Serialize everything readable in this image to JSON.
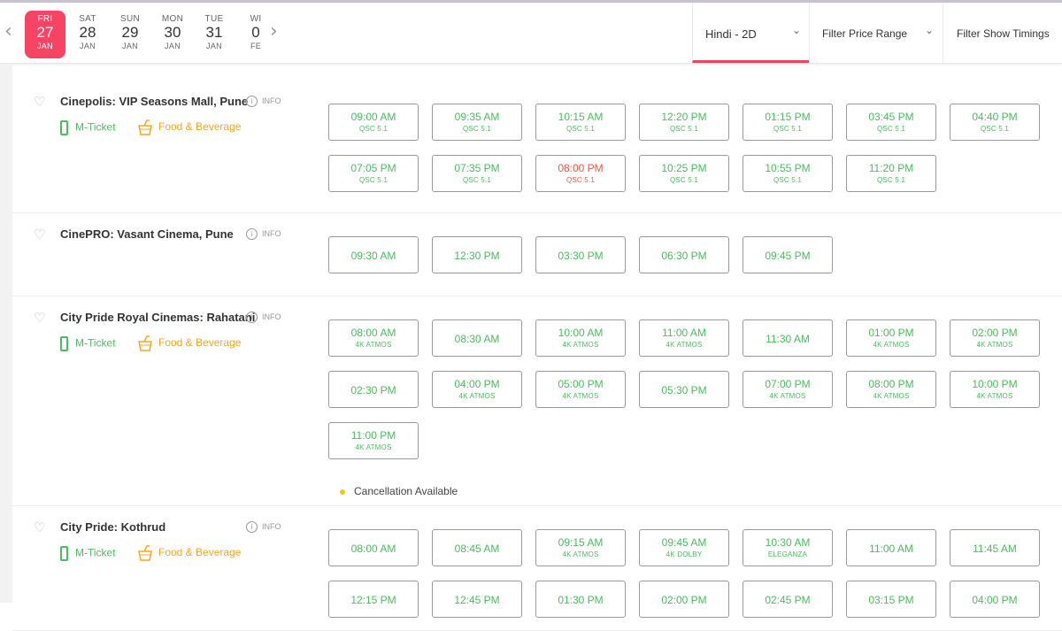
{
  "dates": [
    {
      "dow": "FRI",
      "day": "27",
      "mon": "JAN",
      "active": true
    },
    {
      "dow": "SAT",
      "day": "28",
      "mon": "JAN"
    },
    {
      "dow": "SUN",
      "day": "29",
      "mon": "JAN"
    },
    {
      "dow": "MON",
      "day": "30",
      "mon": "JAN"
    },
    {
      "dow": "TUE",
      "day": "31",
      "mon": "JAN"
    },
    {
      "dow": "WI",
      "day": "0",
      "mon": "FE"
    }
  ],
  "nav": {
    "prev": "‹",
    "next": "›"
  },
  "filters": {
    "language": "Hindi - 2D",
    "price": "Filter Price Range",
    "timings": "Filter Show Timings",
    "chevron": "⌄"
  },
  "icons": {
    "heart": "heart-outline-icon",
    "info": "info-circle-icon",
    "phone": "mobile-phone-icon",
    "food": "food-cup-icon"
  },
  "colors": {
    "accent": "#f84464",
    "available": "#4abd5d",
    "fastfilling": "#f0593e",
    "food": "#f5a623",
    "cancel_dot": "#f5c518"
  },
  "labels": {
    "info": "INFO",
    "info_glyph": "i",
    "mticket": "M-Ticket",
    "food": "Food & Beverage",
    "heart": "♡"
  },
  "venues": [
    {
      "name": "Cinepolis: VIP Seasons Mall, Pune",
      "mticket": true,
      "food": true,
      "showtimes": [
        {
          "time": "09:00 AM",
          "sub": "QSC 5.1"
        },
        {
          "time": "09:35 AM",
          "sub": "QSC 5.1"
        },
        {
          "time": "10:15 AM",
          "sub": "QSC 5.1"
        },
        {
          "time": "12:20 PM",
          "sub": "QSC 5.1"
        },
        {
          "time": "01:15 PM",
          "sub": "QSC 5.1"
        },
        {
          "time": "03:45 PM",
          "sub": "QSC 5.1"
        },
        {
          "time": "04:40 PM",
          "sub": "QSC 5.1"
        },
        {
          "time": "07:05 PM",
          "sub": "QSC 5.1"
        },
        {
          "time": "07:35 PM",
          "sub": "QSC 5.1"
        },
        {
          "time": "08:00 PM",
          "sub": "QSC 5.1",
          "status": "fast"
        },
        {
          "time": "10:25 PM",
          "sub": "QSC 5.1"
        },
        {
          "time": "10:55 PM",
          "sub": "QSC 5.1"
        },
        {
          "time": "11:20 PM",
          "sub": "QSC 5.1"
        }
      ]
    },
    {
      "name": "CinePRO: Vasant Cinema, Pune",
      "mticket": false,
      "food": false,
      "showtimes": [
        {
          "time": "09:30 AM"
        },
        {
          "time": "12:30 PM"
        },
        {
          "time": "03:30 PM"
        },
        {
          "time": "06:30 PM"
        },
        {
          "time": "09:45 PM"
        }
      ]
    },
    {
      "name": "City Pride Royal Cinemas: Rahatani",
      "mticket": true,
      "food": true,
      "cancellation": "Cancellation Available",
      "showtimes": [
        {
          "time": "08:00 AM",
          "sub": "4K ATMOS"
        },
        {
          "time": "08:30 AM"
        },
        {
          "time": "10:00 AM",
          "sub": "4K ATMOS"
        },
        {
          "time": "11:00 AM",
          "sub": "4K ATMOS"
        },
        {
          "time": "11:30 AM"
        },
        {
          "time": "01:00 PM",
          "sub": "4K ATMOS"
        },
        {
          "time": "02:00 PM",
          "sub": "4K ATMOS"
        },
        {
          "time": "02:30 PM"
        },
        {
          "time": "04:00 PM",
          "sub": "4K ATMOS"
        },
        {
          "time": "05:00 PM",
          "sub": "4K ATMOS"
        },
        {
          "time": "05:30 PM"
        },
        {
          "time": "07:00 PM",
          "sub": "4K ATMOS"
        },
        {
          "time": "08:00 PM",
          "sub": "4K ATMOS"
        },
        {
          "time": "10:00 PM",
          "sub": "4K ATMOS"
        },
        {
          "time": "11:00 PM",
          "sub": "4K ATMOS"
        }
      ]
    },
    {
      "name": "City Pride: Kothrud",
      "mticket": true,
      "food": true,
      "showtimes": [
        {
          "time": "08:00 AM"
        },
        {
          "time": "08:45 AM"
        },
        {
          "time": "09:15 AM",
          "sub": "4K ATMOS"
        },
        {
          "time": "09:45 AM",
          "sub": "4K DOLBY"
        },
        {
          "time": "10:30 AM",
          "sub": "ELEGANZA"
        },
        {
          "time": "11:00 AM"
        },
        {
          "time": "11:45 AM"
        },
        {
          "time": "12:15 PM"
        },
        {
          "time": "12:45 PM"
        },
        {
          "time": "01:30 PM"
        },
        {
          "time": "02:00 PM"
        },
        {
          "time": "02:45 PM"
        },
        {
          "time": "03:15 PM"
        },
        {
          "time": "04:00 PM"
        }
      ]
    }
  ]
}
